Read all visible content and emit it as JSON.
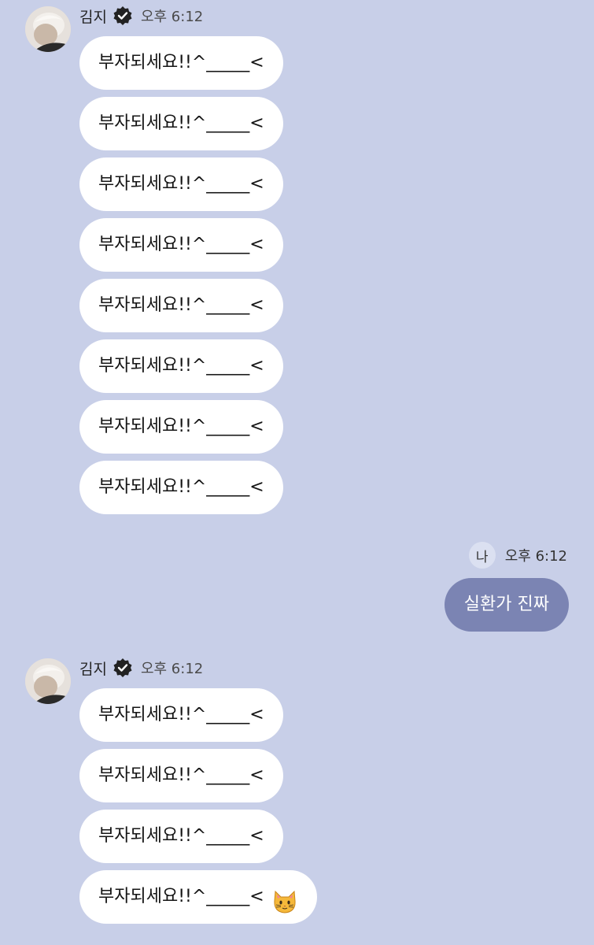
{
  "groups": [
    {
      "sender": "김지",
      "time": "오후 6:12",
      "messages": [
        "부자되세요!!^_____<",
        "부자되세요!!^_____<",
        "부자되세요!!^_____<",
        "부자되세요!!^_____<",
        "부자되세요!!^_____<",
        "부자되세요!!^_____<",
        "부자되세요!!^_____<",
        "부자되세요!!^_____<"
      ]
    },
    {
      "sender": "김지",
      "time": "오후 6:12",
      "messages": [
        "부자되세요!!^_____<",
        "부자되세요!!^_____<",
        "부자되세요!!^_____<",
        "부자되세요!!^_____<"
      ],
      "last_message_icon": "cat-face-emoji"
    }
  ],
  "me": {
    "badge": "나",
    "time": "오후 6:12",
    "message": "실환가 진짜"
  },
  "colors": {
    "background": "#c8cfe8",
    "incoming_bubble": "#ffffff",
    "outgoing_bubble": "#7b84b3",
    "me_badge": "#dbe0f1"
  }
}
